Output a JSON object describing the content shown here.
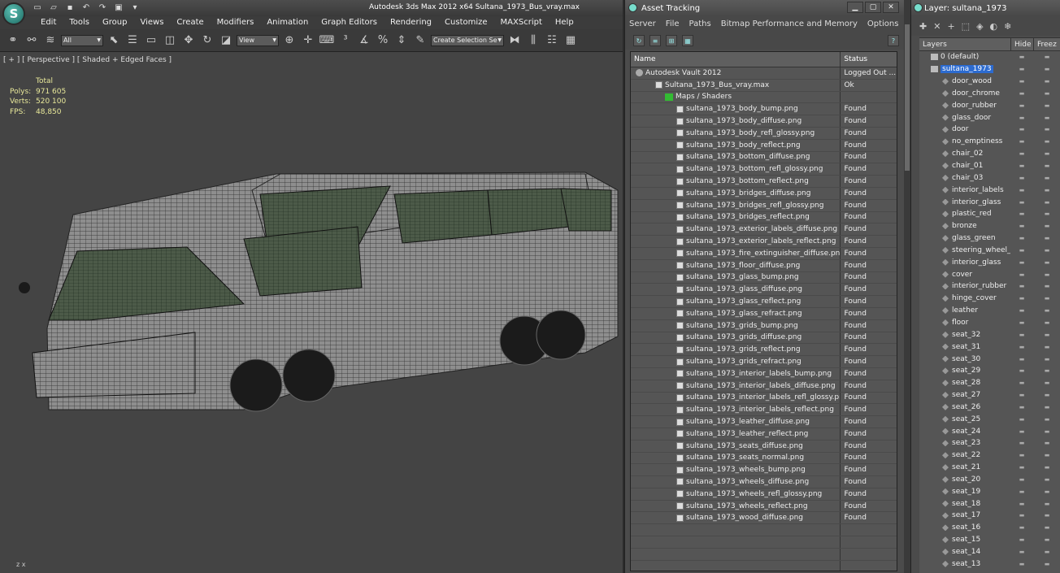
{
  "app": {
    "title": "Autodesk 3ds Max  2012 x64      Sultana_1973_Bus_vray.max",
    "logo": "S",
    "menus": [
      "Edit",
      "Tools",
      "Group",
      "Views",
      "Create",
      "Modifiers",
      "Animation",
      "Graph Editors",
      "Rendering",
      "Customize",
      "MAXScript",
      "Help"
    ],
    "filter_select": "All",
    "view_select": "View",
    "selection_set": "Create Selection Se"
  },
  "viewport": {
    "label": "[ + ] [ Perspective ] [ Shaded + Edged Faces ]",
    "stats_header": "Total",
    "polys_label": "Polys:",
    "polys_value": "971 605",
    "verts_label": "Verts:",
    "verts_value": "520 100",
    "fps_label": "FPS:",
    "fps_value": "48,850",
    "axis_label": "z  x"
  },
  "asset_tracking": {
    "title": "Asset Tracking",
    "menus": [
      "Server",
      "File",
      "Paths",
      "Bitmap Performance and Memory",
      "Options"
    ],
    "col_name": "Name",
    "col_status": "Status",
    "rows": [
      {
        "name": "Autodesk Vault 2012",
        "status": "Logged Out ...",
        "type": "vault",
        "indent": 6
      },
      {
        "name": "Sultana_1973_Bus_vray.max",
        "status": "Ok",
        "type": "max",
        "indent": 30
      },
      {
        "name": "Maps / Shaders",
        "status": "",
        "type": "maps",
        "indent": 42
      },
      {
        "name": "sultana_1973_body_bump.png",
        "status": "Found",
        "type": "file",
        "indent": 56
      },
      {
        "name": "sultana_1973_body_diffuse.png",
        "status": "Found",
        "type": "file",
        "indent": 56
      },
      {
        "name": "sultana_1973_body_refl_glossy.png",
        "status": "Found",
        "type": "file",
        "indent": 56
      },
      {
        "name": "sultana_1973_body_reflect.png",
        "status": "Found",
        "type": "file",
        "indent": 56
      },
      {
        "name": "sultana_1973_bottom_diffuse.png",
        "status": "Found",
        "type": "file",
        "indent": 56
      },
      {
        "name": "sultana_1973_bottom_refl_glossy.png",
        "status": "Found",
        "type": "file",
        "indent": 56
      },
      {
        "name": "sultana_1973_bottom_reflect.png",
        "status": "Found",
        "type": "file",
        "indent": 56
      },
      {
        "name": "sultana_1973_bridges_diffuse.png",
        "status": "Found",
        "type": "file",
        "indent": 56
      },
      {
        "name": "sultana_1973_bridges_refl_glossy.png",
        "status": "Found",
        "type": "file",
        "indent": 56
      },
      {
        "name": "sultana_1973_bridges_reflect.png",
        "status": "Found",
        "type": "file",
        "indent": 56
      },
      {
        "name": "sultana_1973_exterior_labels_diffuse.png",
        "status": "Found",
        "type": "file",
        "indent": 56
      },
      {
        "name": "sultana_1973_exterior_labels_reflect.png",
        "status": "Found",
        "type": "file",
        "indent": 56
      },
      {
        "name": "sultana_1973_fire_extinguisher_diffuse.png",
        "status": "Found",
        "type": "file",
        "indent": 56
      },
      {
        "name": "sultana_1973_floor_diffuse.png",
        "status": "Found",
        "type": "file",
        "indent": 56
      },
      {
        "name": "sultana_1973_glass_bump.png",
        "status": "Found",
        "type": "file",
        "indent": 56
      },
      {
        "name": "sultana_1973_glass_diffuse.png",
        "status": "Found",
        "type": "file",
        "indent": 56
      },
      {
        "name": "sultana_1973_glass_reflect.png",
        "status": "Found",
        "type": "file",
        "indent": 56
      },
      {
        "name": "sultana_1973_glass_refract.png",
        "status": "Found",
        "type": "file",
        "indent": 56
      },
      {
        "name": "sultana_1973_grids_bump.png",
        "status": "Found",
        "type": "file",
        "indent": 56
      },
      {
        "name": "sultana_1973_grids_diffuse.png",
        "status": "Found",
        "type": "file",
        "indent": 56
      },
      {
        "name": "sultana_1973_grids_reflect.png",
        "status": "Found",
        "type": "file",
        "indent": 56
      },
      {
        "name": "sultana_1973_grids_refract.png",
        "status": "Found",
        "type": "file",
        "indent": 56
      },
      {
        "name": "sultana_1973_interior_labels_bump.png",
        "status": "Found",
        "type": "file",
        "indent": 56
      },
      {
        "name": "sultana_1973_interior_labels_diffuse.png",
        "status": "Found",
        "type": "file",
        "indent": 56
      },
      {
        "name": "sultana_1973_interior_labels_refl_glossy.png",
        "status": "Found",
        "type": "file",
        "indent": 56
      },
      {
        "name": "sultana_1973_interior_labels_reflect.png",
        "status": "Found",
        "type": "file",
        "indent": 56
      },
      {
        "name": "sultana_1973_leather_diffuse.png",
        "status": "Found",
        "type": "file",
        "indent": 56
      },
      {
        "name": "sultana_1973_leather_reflect.png",
        "status": "Found",
        "type": "file",
        "indent": 56
      },
      {
        "name": "sultana_1973_seats_diffuse.png",
        "status": "Found",
        "type": "file",
        "indent": 56
      },
      {
        "name": "sultana_1973_seats_normal.png",
        "status": "Found",
        "type": "file",
        "indent": 56
      },
      {
        "name": "sultana_1973_wheels_bump.png",
        "status": "Found",
        "type": "file",
        "indent": 56
      },
      {
        "name": "sultana_1973_wheels_diffuse.png",
        "status": "Found",
        "type": "file",
        "indent": 56
      },
      {
        "name": "sultana_1973_wheels_refl_glossy.png",
        "status": "Found",
        "type": "file",
        "indent": 56
      },
      {
        "name": "sultana_1973_wheels_reflect.png",
        "status": "Found",
        "type": "file",
        "indent": 56
      },
      {
        "name": "sultana_1973_wood_diffuse.png",
        "status": "Found",
        "type": "file",
        "indent": 56
      },
      {
        "name": "",
        "status": "",
        "type": "empty",
        "indent": 0
      },
      {
        "name": "",
        "status": "",
        "type": "empty",
        "indent": 0
      },
      {
        "name": "",
        "status": "",
        "type": "empty",
        "indent": 0
      },
      {
        "name": "",
        "status": "",
        "type": "empty",
        "indent": 0
      }
    ]
  },
  "layers": {
    "title": "Layer: sultana_1973",
    "col_layers": "Layers",
    "col_hide": "Hide",
    "col_freeze": "Freez",
    "rows": [
      {
        "name": "0 (default)",
        "type": "layer",
        "indent": 14,
        "selected": false
      },
      {
        "name": "sultana_1973",
        "type": "layer",
        "indent": 14,
        "selected": true
      },
      {
        "name": "door_wood",
        "type": "obj",
        "indent": 28,
        "selected": false
      },
      {
        "name": "door_chrome",
        "type": "obj",
        "indent": 28,
        "selected": false
      },
      {
        "name": "door_rubber",
        "type": "obj",
        "indent": 28,
        "selected": false
      },
      {
        "name": "glass_door",
        "type": "obj",
        "indent": 28,
        "selected": false
      },
      {
        "name": "door",
        "type": "obj",
        "indent": 28,
        "selected": false
      },
      {
        "name": "no_emptiness",
        "type": "obj",
        "indent": 28,
        "selected": false
      },
      {
        "name": "chair_02",
        "type": "obj",
        "indent": 28,
        "selected": false
      },
      {
        "name": "chair_01",
        "type": "obj",
        "indent": 28,
        "selected": false
      },
      {
        "name": "chair_03",
        "type": "obj",
        "indent": 28,
        "selected": false
      },
      {
        "name": "interior_labels",
        "type": "obj",
        "indent": 28,
        "selected": false
      },
      {
        "name": "interior_glass",
        "type": "obj",
        "indent": 28,
        "selected": false
      },
      {
        "name": "plastic_red",
        "type": "obj",
        "indent": 28,
        "selected": false
      },
      {
        "name": "bronze",
        "type": "obj",
        "indent": 28,
        "selected": false
      },
      {
        "name": "glass_green",
        "type": "obj",
        "indent": 28,
        "selected": false
      },
      {
        "name": "steering_wheel_",
        "type": "obj",
        "indent": 28,
        "selected": false
      },
      {
        "name": "interior_glass",
        "type": "obj",
        "indent": 28,
        "selected": false
      },
      {
        "name": "cover",
        "type": "obj",
        "indent": 28,
        "selected": false
      },
      {
        "name": "interior_rubber",
        "type": "obj",
        "indent": 28,
        "selected": false
      },
      {
        "name": "hinge_cover",
        "type": "obj",
        "indent": 28,
        "selected": false
      },
      {
        "name": "leather",
        "type": "obj",
        "indent": 28,
        "selected": false
      },
      {
        "name": "floor",
        "type": "obj",
        "indent": 28,
        "selected": false
      },
      {
        "name": "seat_32",
        "type": "obj",
        "indent": 28,
        "selected": false
      },
      {
        "name": "seat_31",
        "type": "obj",
        "indent": 28,
        "selected": false
      },
      {
        "name": "seat_30",
        "type": "obj",
        "indent": 28,
        "selected": false
      },
      {
        "name": "seat_29",
        "type": "obj",
        "indent": 28,
        "selected": false
      },
      {
        "name": "seat_28",
        "type": "obj",
        "indent": 28,
        "selected": false
      },
      {
        "name": "seat_27",
        "type": "obj",
        "indent": 28,
        "selected": false
      },
      {
        "name": "seat_26",
        "type": "obj",
        "indent": 28,
        "selected": false
      },
      {
        "name": "seat_25",
        "type": "obj",
        "indent": 28,
        "selected": false
      },
      {
        "name": "seat_24",
        "type": "obj",
        "indent": 28,
        "selected": false
      },
      {
        "name": "seat_23",
        "type": "obj",
        "indent": 28,
        "selected": false
      },
      {
        "name": "seat_22",
        "type": "obj",
        "indent": 28,
        "selected": false
      },
      {
        "name": "seat_21",
        "type": "obj",
        "indent": 28,
        "selected": false
      },
      {
        "name": "seat_20",
        "type": "obj",
        "indent": 28,
        "selected": false
      },
      {
        "name": "seat_19",
        "type": "obj",
        "indent": 28,
        "selected": false
      },
      {
        "name": "seat_18",
        "type": "obj",
        "indent": 28,
        "selected": false
      },
      {
        "name": "seat_17",
        "type": "obj",
        "indent": 28,
        "selected": false
      },
      {
        "name": "seat_16",
        "type": "obj",
        "indent": 28,
        "selected": false
      },
      {
        "name": "seat_15",
        "type": "obj",
        "indent": 28,
        "selected": false
      },
      {
        "name": "seat_14",
        "type": "obj",
        "indent": 28,
        "selected": false
      },
      {
        "name": "seat_13",
        "type": "obj",
        "indent": 28,
        "selected": false
      }
    ]
  }
}
